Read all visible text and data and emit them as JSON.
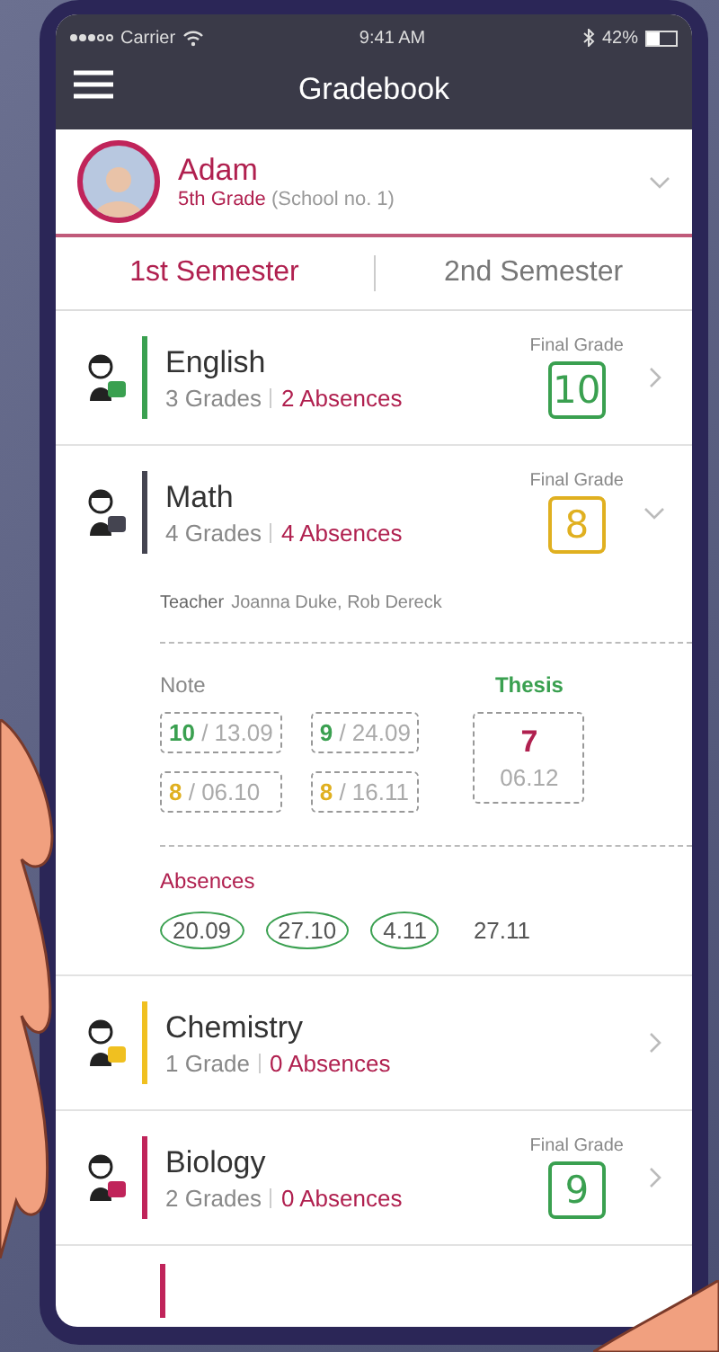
{
  "status_bar": {
    "carrier": "Carrier",
    "time": "9:41 AM",
    "battery": "42%"
  },
  "header": {
    "title": "Gradebook"
  },
  "student": {
    "name": "Adam",
    "grade": "5th Grade",
    "school": "(School no. 1)"
  },
  "semesters": [
    {
      "label": "1st Semester",
      "selected": true
    },
    {
      "label": "2nd Semester",
      "selected": false
    }
  ],
  "subjects": [
    {
      "name": "English",
      "color": "#3aa050",
      "grades": "3 Grades",
      "absences": "2 Absences",
      "expanded": false,
      "final": {
        "label": "Final Grade",
        "value": "10",
        "color": "#3aa050"
      }
    },
    {
      "name": "Math",
      "color": "#444450",
      "grades": "4 Grades",
      "absences": "4 Absences",
      "expanded": true,
      "final": {
        "label": "Final Grade",
        "value": "8",
        "color": "#e0b020"
      },
      "details": {
        "teacher_label": "Teacher",
        "teacher": "Joanna Duke, Rob Dereck",
        "notes_label": "Note",
        "notes": [
          {
            "grade": "10",
            "date": "/ 13.09",
            "color": "#3aa050"
          },
          {
            "grade": "9",
            "date": "/ 24.09",
            "color": "#3aa050"
          },
          {
            "grade": "8",
            "date": "/ 06.10",
            "color": "#e0b020"
          },
          {
            "grade": "8",
            "date": "/ 16.11",
            "color": "#e0b020"
          }
        ],
        "thesis": {
          "label": "Thesis",
          "grade": "7",
          "date": "06.12"
        },
        "absences_label": "Absences",
        "absences": [
          {
            "date": "20.09",
            "circled": true
          },
          {
            "date": "27.10",
            "circled": true
          },
          {
            "date": "4.11",
            "circled": true
          },
          {
            "date": "27.11",
            "circled": false
          }
        ]
      }
    },
    {
      "name": "Chemistry",
      "color": "#f0c020",
      "grades": "1 Grade",
      "absences": "0 Absences",
      "expanded": false
    },
    {
      "name": "Biology",
      "color": "#c0245a",
      "grades": "2 Grades",
      "absences": "0 Absences",
      "expanded": false,
      "final": {
        "label": "Final Grade",
        "value": "9",
        "color": "#3aa050"
      }
    }
  ]
}
